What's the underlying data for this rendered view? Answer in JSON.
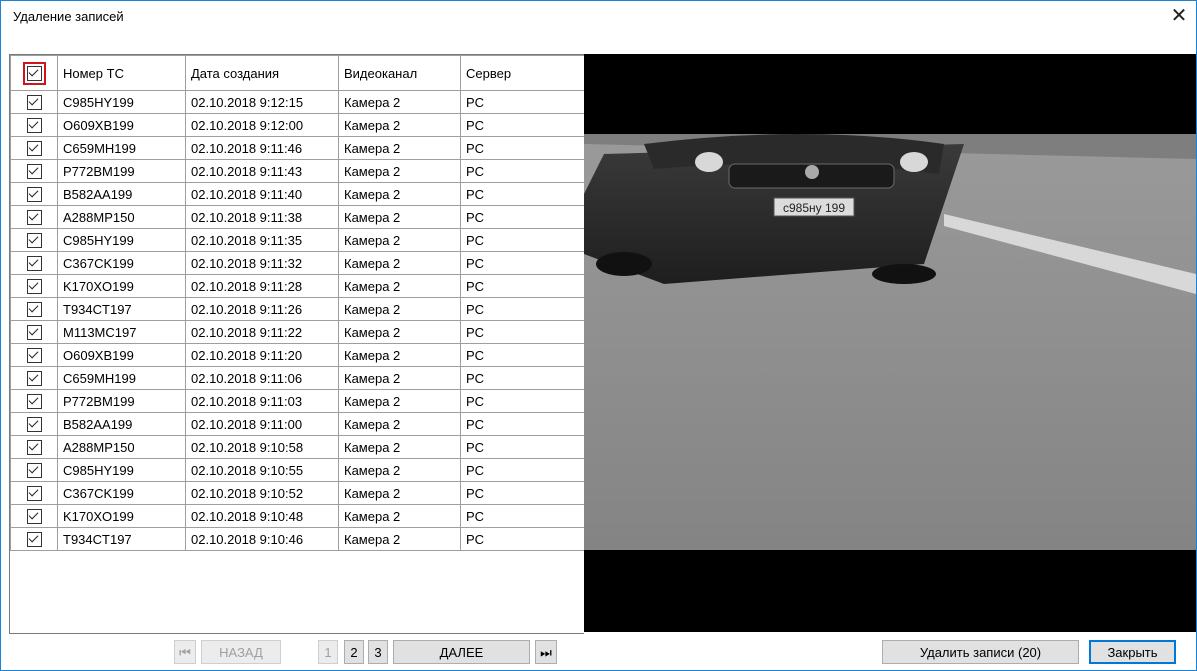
{
  "window": {
    "title": "Удаление записей",
    "close_glyph": "✕"
  },
  "table": {
    "columns": [
      "Номер ТС",
      "Дата создания",
      "Видеоканал",
      "Сервер"
    ],
    "rows": [
      [
        "C985HY199",
        "02.10.2018 9:12:15",
        "Камера 2",
        "PC"
      ],
      [
        "O609XB199",
        "02.10.2018 9:12:00",
        "Камера 2",
        "PC"
      ],
      [
        "C659MH199",
        "02.10.2018 9:11:46",
        "Камера 2",
        "PC"
      ],
      [
        "P772BM199",
        "02.10.2018 9:11:43",
        "Камера 2",
        "PC"
      ],
      [
        "B582AA199",
        "02.10.2018 9:11:40",
        "Камера 2",
        "PC"
      ],
      [
        "A288MP150",
        "02.10.2018 9:11:38",
        "Камера 2",
        "PC"
      ],
      [
        "C985HY199",
        "02.10.2018 9:11:35",
        "Камера 2",
        "PC"
      ],
      [
        "C367CK199",
        "02.10.2018 9:11:32",
        "Камера 2",
        "PC"
      ],
      [
        "K170XO199",
        "02.10.2018 9:11:28",
        "Камера 2",
        "PC"
      ],
      [
        "T934CT197",
        "02.10.2018 9:11:26",
        "Камера 2",
        "PC"
      ],
      [
        "M113MC197",
        "02.10.2018 9:11:22",
        "Камера 2",
        "PC"
      ],
      [
        "O609XB199",
        "02.10.2018 9:11:20",
        "Камера 2",
        "PC"
      ],
      [
        "C659MH199",
        "02.10.2018 9:11:06",
        "Камера 2",
        "PC"
      ],
      [
        "P772BM199",
        "02.10.2018 9:11:03",
        "Камера 2",
        "PC"
      ],
      [
        "B582AA199",
        "02.10.2018 9:11:00",
        "Камера 2",
        "PC"
      ],
      [
        "A288MP150",
        "02.10.2018 9:10:58",
        "Камера 2",
        "PC"
      ],
      [
        "C985HY199",
        "02.10.2018 9:10:55",
        "Камера 2",
        "PC"
      ],
      [
        "C367CK199",
        "02.10.2018 9:10:52",
        "Камера 2",
        "PC"
      ],
      [
        "K170XO199",
        "02.10.2018 9:10:48",
        "Камера 2",
        "PC"
      ],
      [
        "T934CT197",
        "02.10.2018 9:10:46",
        "Камера 2",
        "PC"
      ]
    ]
  },
  "preview": {
    "plate_text": "c985ну 199"
  },
  "pagination": {
    "first_glyph": "⏮",
    "back_label": "НАЗАД",
    "pages": [
      "1",
      "2",
      "3"
    ],
    "next_label": "ДАЛЕЕ",
    "last_glyph": "⏭"
  },
  "actions": {
    "delete_label": "Удалить записи (20)",
    "close_label": "Закрыть"
  },
  "colors": {
    "accent": "#0078d7",
    "highlight_border": "#d0141b"
  }
}
